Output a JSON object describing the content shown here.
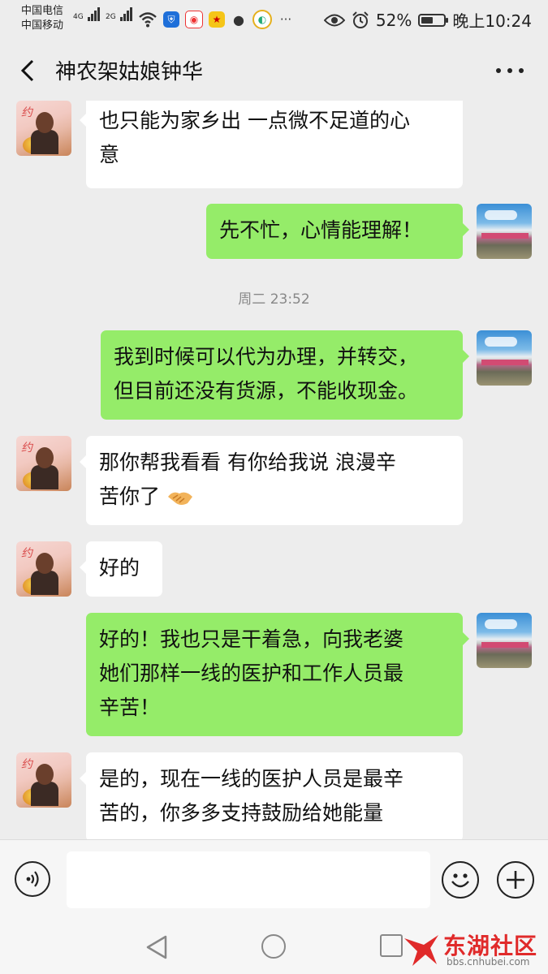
{
  "status_bar": {
    "carrier_1": "中国电信",
    "carrier_2": "中国移动",
    "network_1": "4G",
    "network_2": "2G",
    "battery": "52%",
    "battery_level": 0.52,
    "time": "晚上10:24",
    "app_icons": [
      "shield-app-icon",
      "weibo-app-icon",
      "star-app-icon",
      "wechat-app-icon",
      "browser-app-icon",
      "more-apps-icon"
    ]
  },
  "header": {
    "title": "神农架姑娘钟华"
  },
  "messages": [
    {
      "id": "m1",
      "sender": "contact",
      "lines": [
        "也只能为家乡出 一点微不足道的心",
        "意"
      ]
    },
    {
      "id": "m2",
      "sender": "me",
      "lines": [
        "先不忙，心情能理解！"
      ]
    },
    {
      "id": "t1",
      "type": "timestamp",
      "text": "周二 23:52"
    },
    {
      "id": "m3",
      "sender": "me",
      "lines": [
        "我到时候可以代为办理，并转交，",
        "但目前还没有货源，不能收现金。"
      ]
    },
    {
      "id": "m4",
      "sender": "contact",
      "lines": [
        "那你帮我看看 有你给我说  浪漫辛",
        "苦你了 "
      ],
      "emoji": "handshake-icon"
    },
    {
      "id": "m5",
      "sender": "contact",
      "lines": [
        "好的"
      ]
    },
    {
      "id": "m6",
      "sender": "me",
      "lines": [
        "好的！我也只是干着急，向我老婆",
        "她们那样一线的医护和工作人员最",
        "辛苦！"
      ]
    },
    {
      "id": "m7",
      "sender": "contact",
      "lines": [
        "是的，现在一线的医护人员是最辛",
        "苦的，你多多支持鼓励给她能量"
      ]
    }
  ],
  "input": {
    "value": ""
  },
  "watermark": {
    "name": "东湖社区",
    "url": "bbs.cnhubei.com"
  },
  "colors": {
    "background": "#ededed",
    "outgoing_bubble": "#95ec69",
    "incoming_bubble": "#ffffff",
    "watermark_red": "#e02a2a"
  }
}
